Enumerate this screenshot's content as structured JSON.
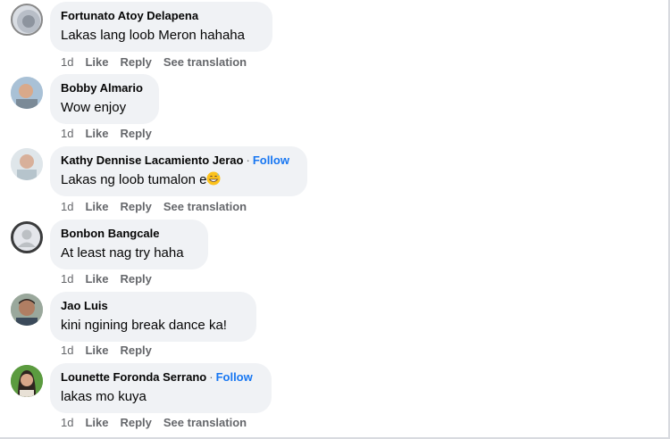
{
  "comments": [
    {
      "name": "Fortunato Atoy Delapena",
      "text": "Lakas lang loob Meron hahaha",
      "time": "1d",
      "like": "Like",
      "reply": "Reply",
      "translate": "See translation"
    },
    {
      "name": "Bobby Almario",
      "text": "Wow enjoy",
      "time": "1d",
      "like": "Like",
      "reply": "Reply"
    },
    {
      "name": "Kathy Dennise Lacamiento Jerao",
      "follow": "Follow",
      "text": "Lakas ng loob tumalon e",
      "emoji": "grinning-sweat-emoji",
      "time": "1d",
      "like": "Like",
      "reply": "Reply",
      "translate": "See translation"
    },
    {
      "name": "Bonbon Bangcale",
      "text": "At least nag try haha",
      "time": "1d",
      "like": "Like",
      "reply": "Reply"
    },
    {
      "name": "Jao Luis",
      "text": "kini ngining break dance ka!",
      "time": "1d",
      "like": "Like",
      "reply": "Reply"
    },
    {
      "name": "Lounette Foronda Serrano",
      "follow": "Follow",
      "text": "lakas mo kuya",
      "time": "1d",
      "like": "Like",
      "reply": "Reply",
      "translate": "See translation"
    }
  ],
  "separator": "·",
  "colors": {
    "bubble": "#f0f2f5",
    "name": "#050505",
    "meta": "#65676b",
    "follow": "#1877f2"
  }
}
